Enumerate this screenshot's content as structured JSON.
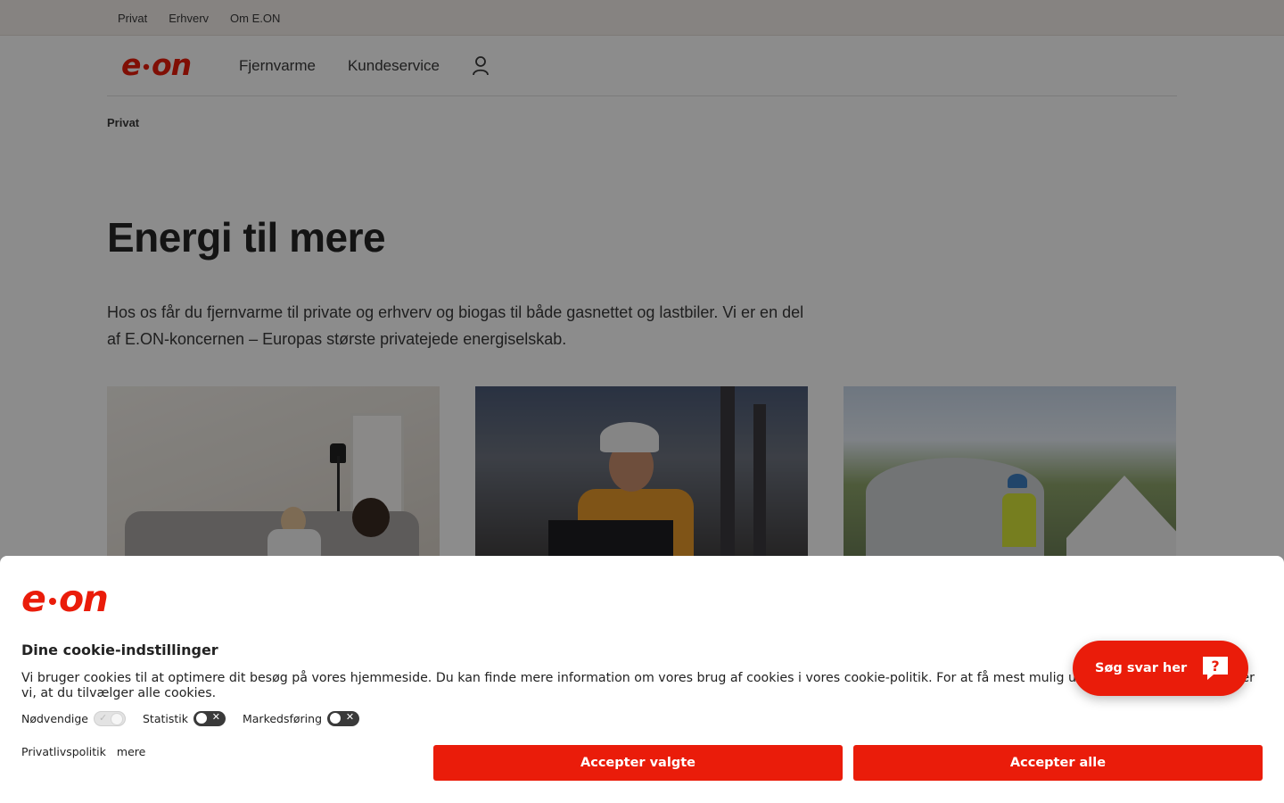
{
  "topbar": {
    "links": [
      "Privat",
      "Erhverv",
      "Om E.ON"
    ]
  },
  "header": {
    "logo_alt": "e·on",
    "nav": [
      "Fjernvarme",
      "Kundeservice"
    ],
    "user_icon": "user-icon"
  },
  "breadcrumb": "Privat",
  "hero": {
    "title": "Energi til mere",
    "text": "Hos os får du fjernvarme til private og erhverv og biogas til både gasnettet og lastbiler. Vi er en del af E.ON-koncernen – Europas største privatejede energiselskab."
  },
  "cookie": {
    "title": "Dine cookie-indstillinger",
    "text": "Vi bruger cookies til at optimere dit besøg på vores hjemmeside. Du kan finde mere information om vores brug af cookies i vores cookie-politik. For at få mest mulig ud af hjemmesiden anbefaler vi, at du tilvælger alle cookies.",
    "toggles": [
      {
        "label": "Nødvendige",
        "state": "on-disabled"
      },
      {
        "label": "Statistik",
        "state": "off"
      },
      {
        "label": "Markedsføring",
        "state": "off"
      }
    ],
    "links": [
      "Privatlivspolitik",
      "mere"
    ],
    "accept_selected": "Accepter valgte",
    "accept_all": "Accepter alle"
  },
  "help": {
    "label": "Søg svar her",
    "icon": "question-bubble-icon"
  },
  "colors": {
    "brand": "#ea1c0a"
  }
}
